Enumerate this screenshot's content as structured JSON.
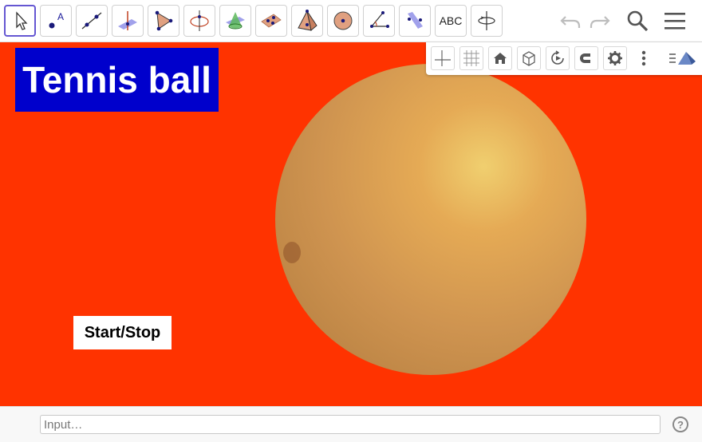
{
  "toolbar": {
    "text_tool_label": "ABC",
    "tools": [
      "move-tool",
      "point-tool",
      "line-tool",
      "perpendicular-tool",
      "polygon-tool",
      "circle-axis-tool",
      "intersect-surfaces-tool",
      "plane-three-points-tool",
      "pyramid-tool",
      "sphere-tool",
      "angle-tool",
      "reflect-tool",
      "text-tool",
      "rotate-view-tool"
    ]
  },
  "graphics": {
    "title": "Tennis ball",
    "button_label": "Start/Stop",
    "colors": {
      "background": "#ff3300",
      "title_bg": "#0000cc",
      "ball": "#e5aa55"
    }
  },
  "input": {
    "placeholder": "Input…",
    "help_symbol": "?"
  }
}
